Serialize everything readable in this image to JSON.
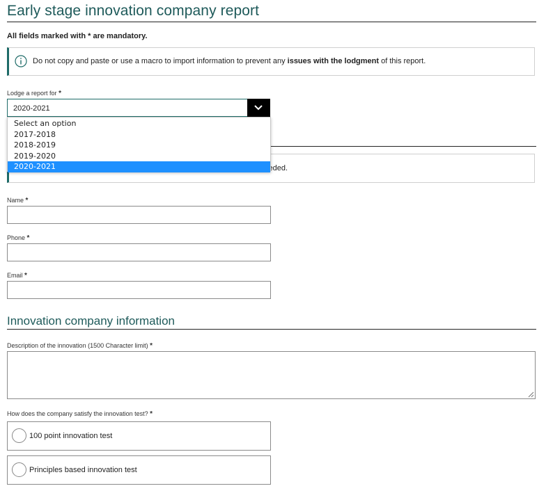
{
  "header": {
    "title": "Early stage innovation company report",
    "mandatory_note": "All fields marked with * are mandatory."
  },
  "notice": {
    "text_before": "Do not copy and paste or use a macro to import information to prevent any ",
    "text_bold": "issues with the lodgment",
    "text_after": " of this report.",
    "icon": "info-circle-icon"
  },
  "lodge": {
    "label": "Lodge a report for",
    "required_marker": "*",
    "selected_value": "2020-2021",
    "options": [
      "Select an option",
      "2017-2018",
      "2018-2019",
      "2019-2020",
      "2020-2021"
    ],
    "selected_index": 4
  },
  "contact_notice": {
    "partial_text": "eded."
  },
  "fields": {
    "name_label": "Name",
    "phone_label": "Phone",
    "email_label": "Email",
    "required_marker": "*"
  },
  "innovation": {
    "section_title": "Innovation company information",
    "description_label": "Description of the innovation (1500 Character limit)",
    "test_question": "How does the company satisfy the innovation test?",
    "required_marker": "*",
    "options": [
      "100 point innovation test",
      "Principles based innovation test"
    ]
  },
  "colors": {
    "heading": "#1e5a5a",
    "accent": "#1e6b68",
    "selected_option_bg": "#1e90ff"
  }
}
